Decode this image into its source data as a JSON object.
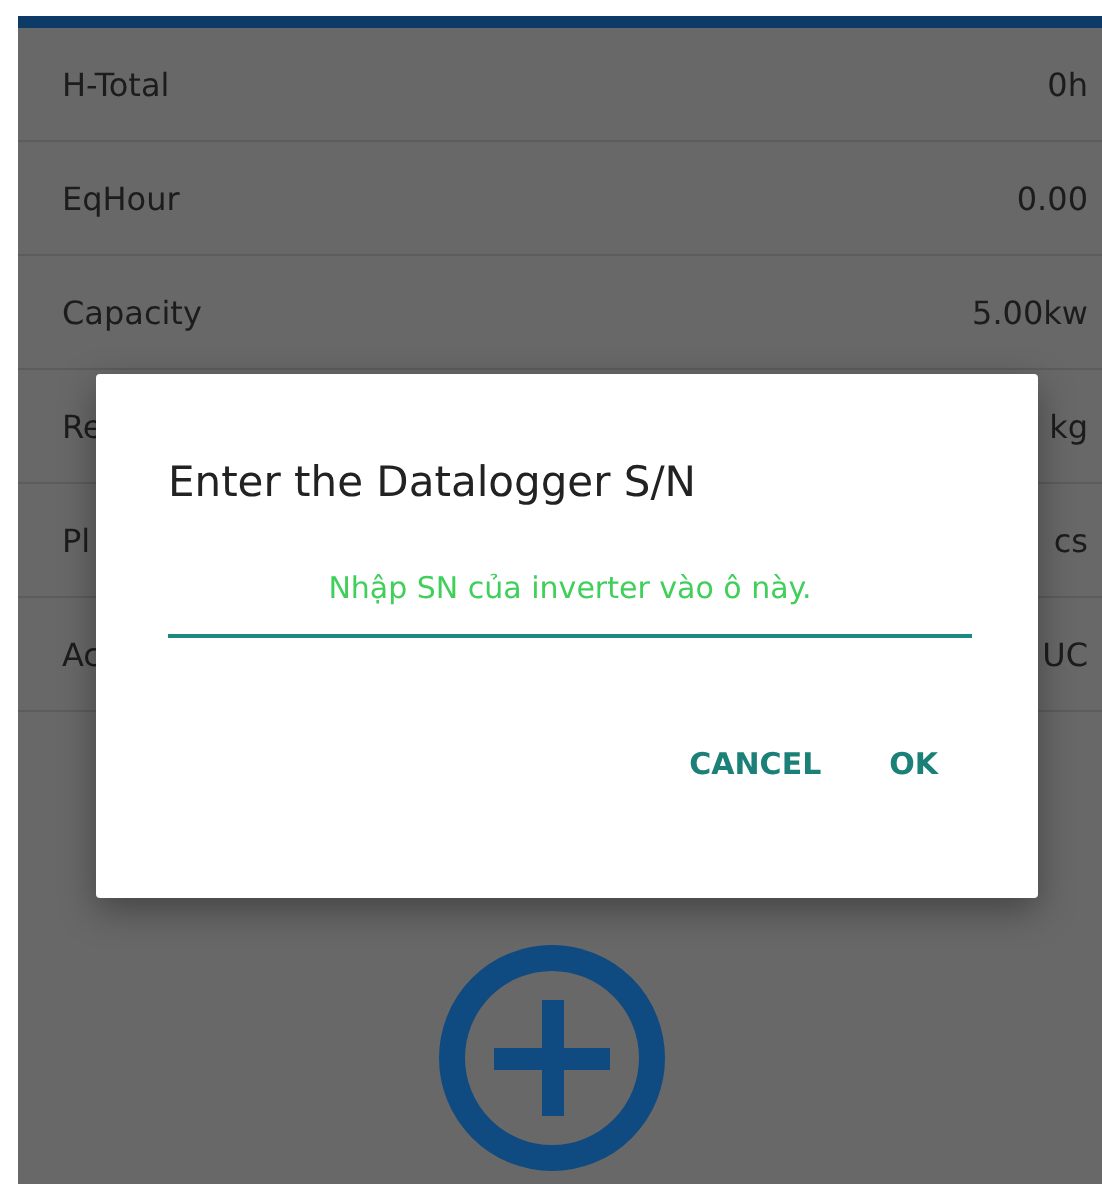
{
  "rows": [
    {
      "label": "H-Total",
      "value": "0h"
    },
    {
      "label": "EqHour",
      "value": "0.00"
    },
    {
      "label": "Capacity",
      "value": "5.00kw"
    },
    {
      "label": "Re",
      "value": "kg"
    },
    {
      "label": "Pl",
      "value": "cs"
    },
    {
      "label": "Ac",
      "value": "UC"
    }
  ],
  "dialog": {
    "title": "Enter the Datalogger S/N",
    "field": {
      "placeholder": "Nhập SN của inverter vào ô này."
    },
    "buttons": [
      "CANCEL",
      "OK"
    ]
  }
}
